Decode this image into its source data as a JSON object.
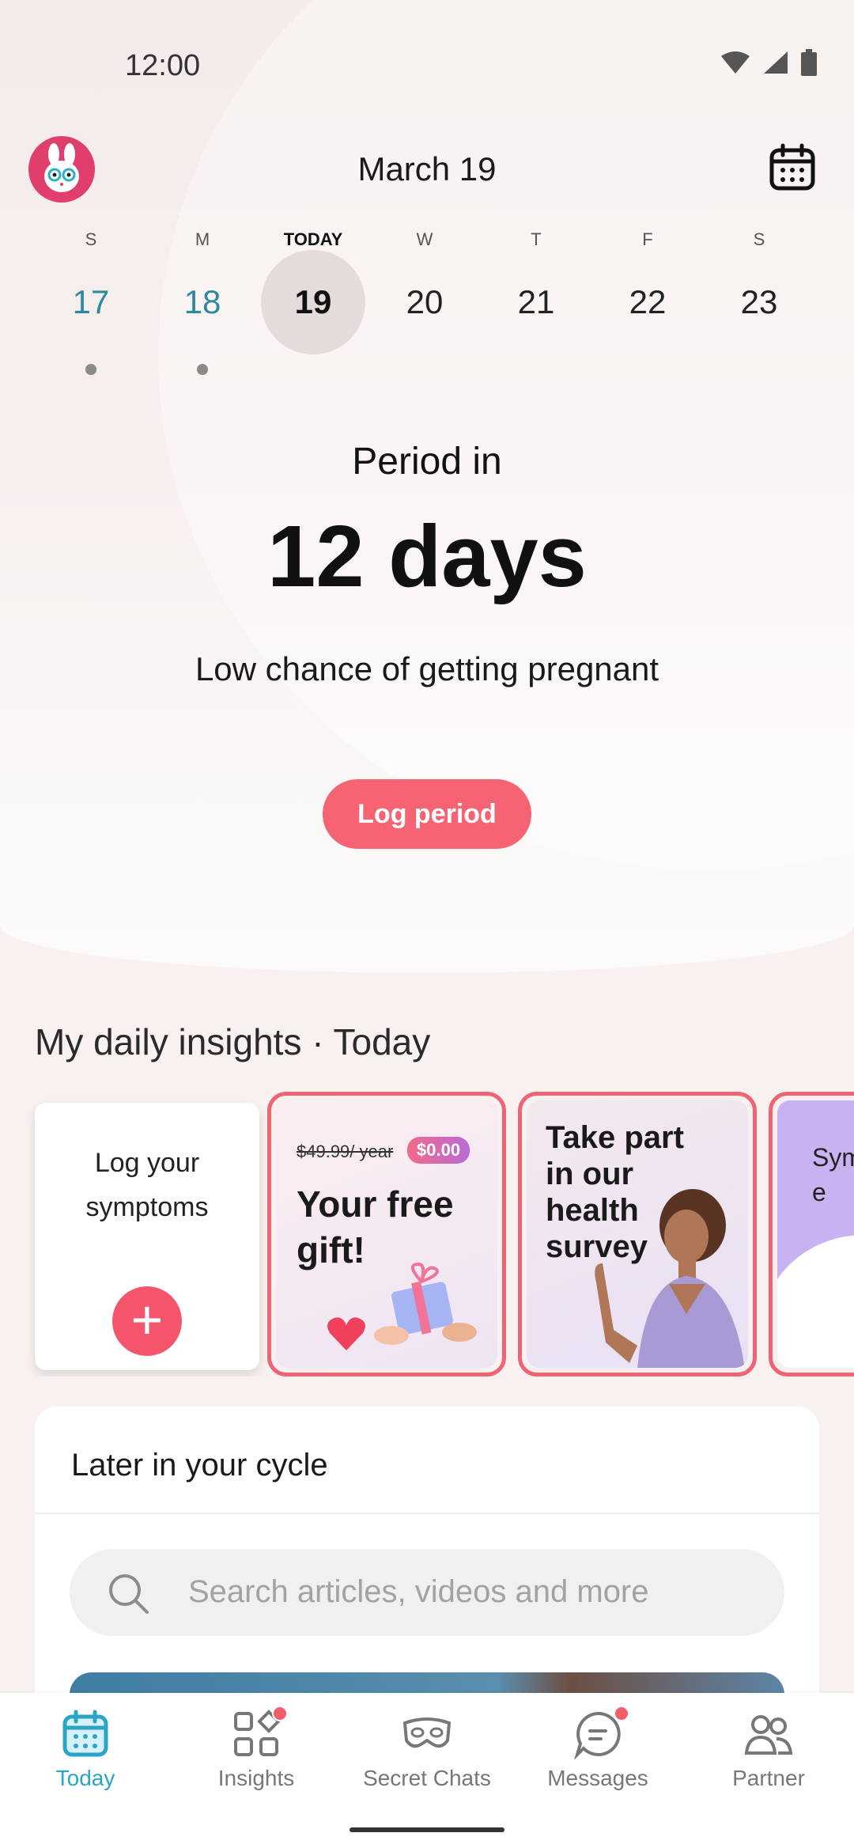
{
  "status_bar": {
    "time": "12:00"
  },
  "header": {
    "title": "March 19"
  },
  "week": [
    {
      "dow": "S",
      "num": "17",
      "state": "past",
      "dot": true
    },
    {
      "dow": "M",
      "num": "18",
      "state": "past",
      "dot": true
    },
    {
      "dow": "TODAY",
      "num": "19",
      "state": "selected",
      "dot": false
    },
    {
      "dow": "W",
      "num": "20",
      "state": "future",
      "dot": false
    },
    {
      "dow": "T",
      "num": "21",
      "state": "future",
      "dot": false
    },
    {
      "dow": "F",
      "num": "22",
      "state": "future",
      "dot": false
    },
    {
      "dow": "S",
      "num": "23",
      "state": "future",
      "dot": false
    }
  ],
  "period": {
    "label": "Period in",
    "value": "12 days",
    "chance": "Low chance of getting pregnant",
    "button": "Log period"
  },
  "insights": {
    "title": "My daily insights · Today",
    "log_card": "Log your symptoms",
    "gift_card": {
      "old_price": "$49.99/ year",
      "badge": "$0.00",
      "title": "Your free gift!"
    },
    "survey_card": {
      "title": "Take part in our health survey"
    },
    "partial_card": {
      "text": "Sym e"
    }
  },
  "later": {
    "title": "Later in your cycle",
    "search_placeholder": "Search articles, videos and more"
  },
  "nav": [
    {
      "label": "Today",
      "icon": "calendar-icon",
      "active": true,
      "notif": false
    },
    {
      "label": "Insights",
      "icon": "grid-icon",
      "active": false,
      "notif": true
    },
    {
      "label": "Secret Chats",
      "icon": "mask-icon",
      "active": false,
      "notif": false
    },
    {
      "label": "Messages",
      "icon": "chat-icon",
      "active": false,
      "notif": true
    },
    {
      "label": "Partner",
      "icon": "partner-icon",
      "active": false,
      "notif": false
    }
  ],
  "colors": {
    "accent_pink": "#f66373",
    "accent_teal": "#2ba4c6",
    "past_day": "#2b8a9e"
  }
}
